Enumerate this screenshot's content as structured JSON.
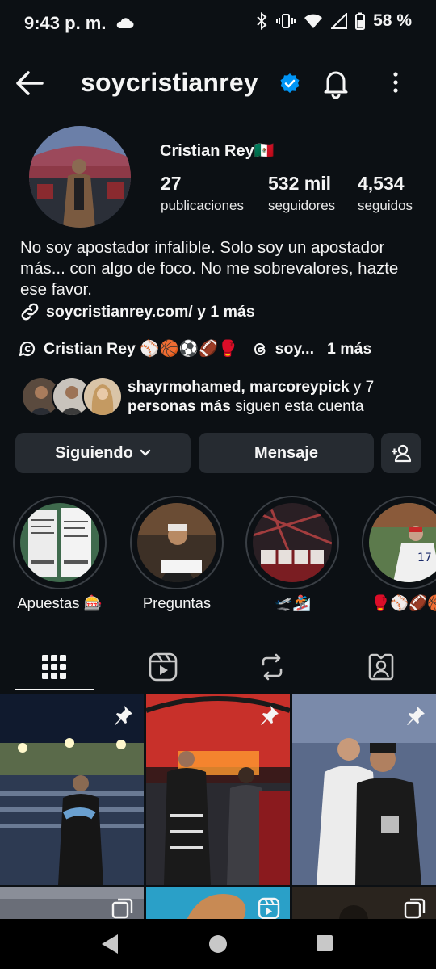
{
  "status": {
    "time": "9:43 p. m.",
    "battery": "58 %"
  },
  "header": {
    "username": "soycristianrey"
  },
  "profile": {
    "full_name": "Cristian Rey",
    "flag": "🇲🇽",
    "stats": [
      {
        "value": "27",
        "label": "publicaciones"
      },
      {
        "value": "532 mil",
        "label": "seguidores"
      },
      {
        "value": "4,534",
        "label": "seguidos"
      }
    ],
    "bio": "No soy apostador infalible. Solo soy un apostador más... con algo de foco. No me sobrevalores, hazte ese favor.",
    "link": "soycristianrey.com/ y 1 más",
    "threads_name": "Cristian Rey ⚾🏀⚽🏈🥊",
    "threads_short": "soy...",
    "threads_more": "1 más",
    "followed_by_names": "shayrmohamed, marcoreypick",
    "followed_by_and": " y 7 ",
    "followed_by_count": "personas más",
    "followed_by_tail": " siguen esta cuenta"
  },
  "actions": {
    "following": "Siguiendo",
    "message": "Mensaje"
  },
  "highlights": [
    {
      "label": "Apuestas 🎰"
    },
    {
      "label": "Preguntas"
    },
    {
      "label": "🛫🏂"
    },
    {
      "label": "🥊⚾🏈🏀"
    }
  ],
  "tabs": [
    "posts-grid",
    "reels",
    "reposts",
    "tagged"
  ],
  "colors": {
    "background": "#0c1014",
    "button": "#262b31",
    "verified": "#0095f6"
  }
}
